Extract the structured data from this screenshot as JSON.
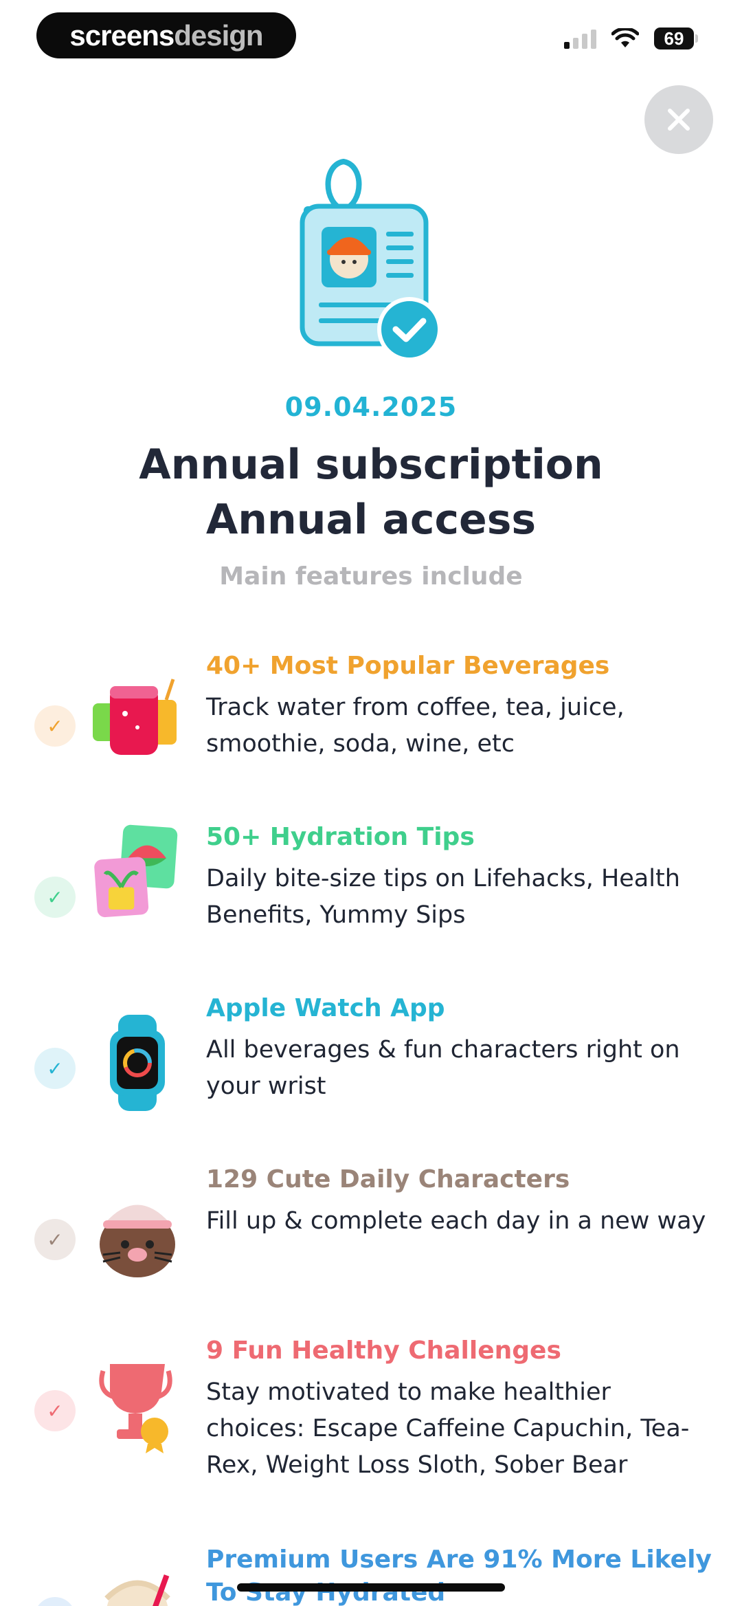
{
  "status_bar": {
    "brand_left": "screens",
    "brand_right": "design",
    "battery": "69"
  },
  "header": {
    "date": "09.04.2025",
    "title_line1": "Annual subscription",
    "title_line2": "Annual access",
    "subtitle": "Main features include"
  },
  "features": [
    {
      "title": "40+ Most Popular Beverages",
      "description": "Track water from coffee, tea, juice, smoothie, soda, wine, etc",
      "color": "#f0a22e"
    },
    {
      "title": "50+ Hydration Tips",
      "description": "Daily bite-size tips on Lifehacks, Health Benefits, Yummy Sips",
      "color": "#3fcf8c"
    },
    {
      "title": "Apple Watch App",
      "description": "All beverages & fun characters right on your wrist",
      "color": "#25b4d3"
    },
    {
      "title": "129 Cute Daily Characters",
      "description": "Fill up & complete each day in a new way",
      "color": "#9a8478"
    },
    {
      "title": "9 Fun Healthy Challenges",
      "description": "Stay motivated to make healthier choices: Escape Caffeine Capuchin, Tea-Rex, Weight Loss Sloth, Sober Bear",
      "color": "#ee6a72"
    },
    {
      "title": "Premium Users Are 91% More Likely To Stay Hydrated",
      "description": "",
      "color": "#3f97dd"
    }
  ],
  "icons": [
    "close-icon",
    "id-badge-icon",
    "beverages-icon",
    "hydration-tips-icon",
    "apple-watch-icon",
    "daily-character-icon",
    "trophy-icon",
    "premium-users-icon",
    "check-icon"
  ]
}
